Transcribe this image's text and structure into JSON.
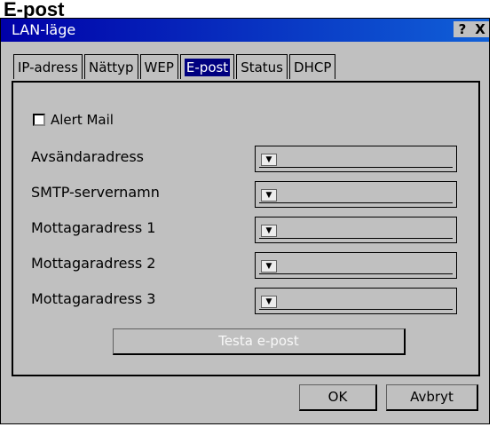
{
  "page_heading": "E-post",
  "window": {
    "title": "LAN-läge",
    "help_glyph": "?",
    "close_glyph": "X"
  },
  "tabs": [
    {
      "label": "IP-adress"
    },
    {
      "label": "Nättyp"
    },
    {
      "label": "WEP"
    },
    {
      "label": "E-post",
      "active": true
    },
    {
      "label": "Status"
    },
    {
      "label": "DHCP"
    }
  ],
  "alert_mail": {
    "label": "Alert Mail",
    "checked": false
  },
  "fields": [
    {
      "label": "Avsändaradress",
      "value": ""
    },
    {
      "label": "SMTP-servernamn",
      "value": ""
    },
    {
      "label": "Mottagaradress 1",
      "value": ""
    },
    {
      "label": "Mottagaradress 2",
      "value": ""
    },
    {
      "label": "Mottagaradress 3",
      "value": ""
    }
  ],
  "dropdown_glyph": "▼",
  "test_button": {
    "label": "Testa e-post",
    "enabled": false
  },
  "buttons": {
    "ok": "OK",
    "cancel": "Avbryt"
  }
}
